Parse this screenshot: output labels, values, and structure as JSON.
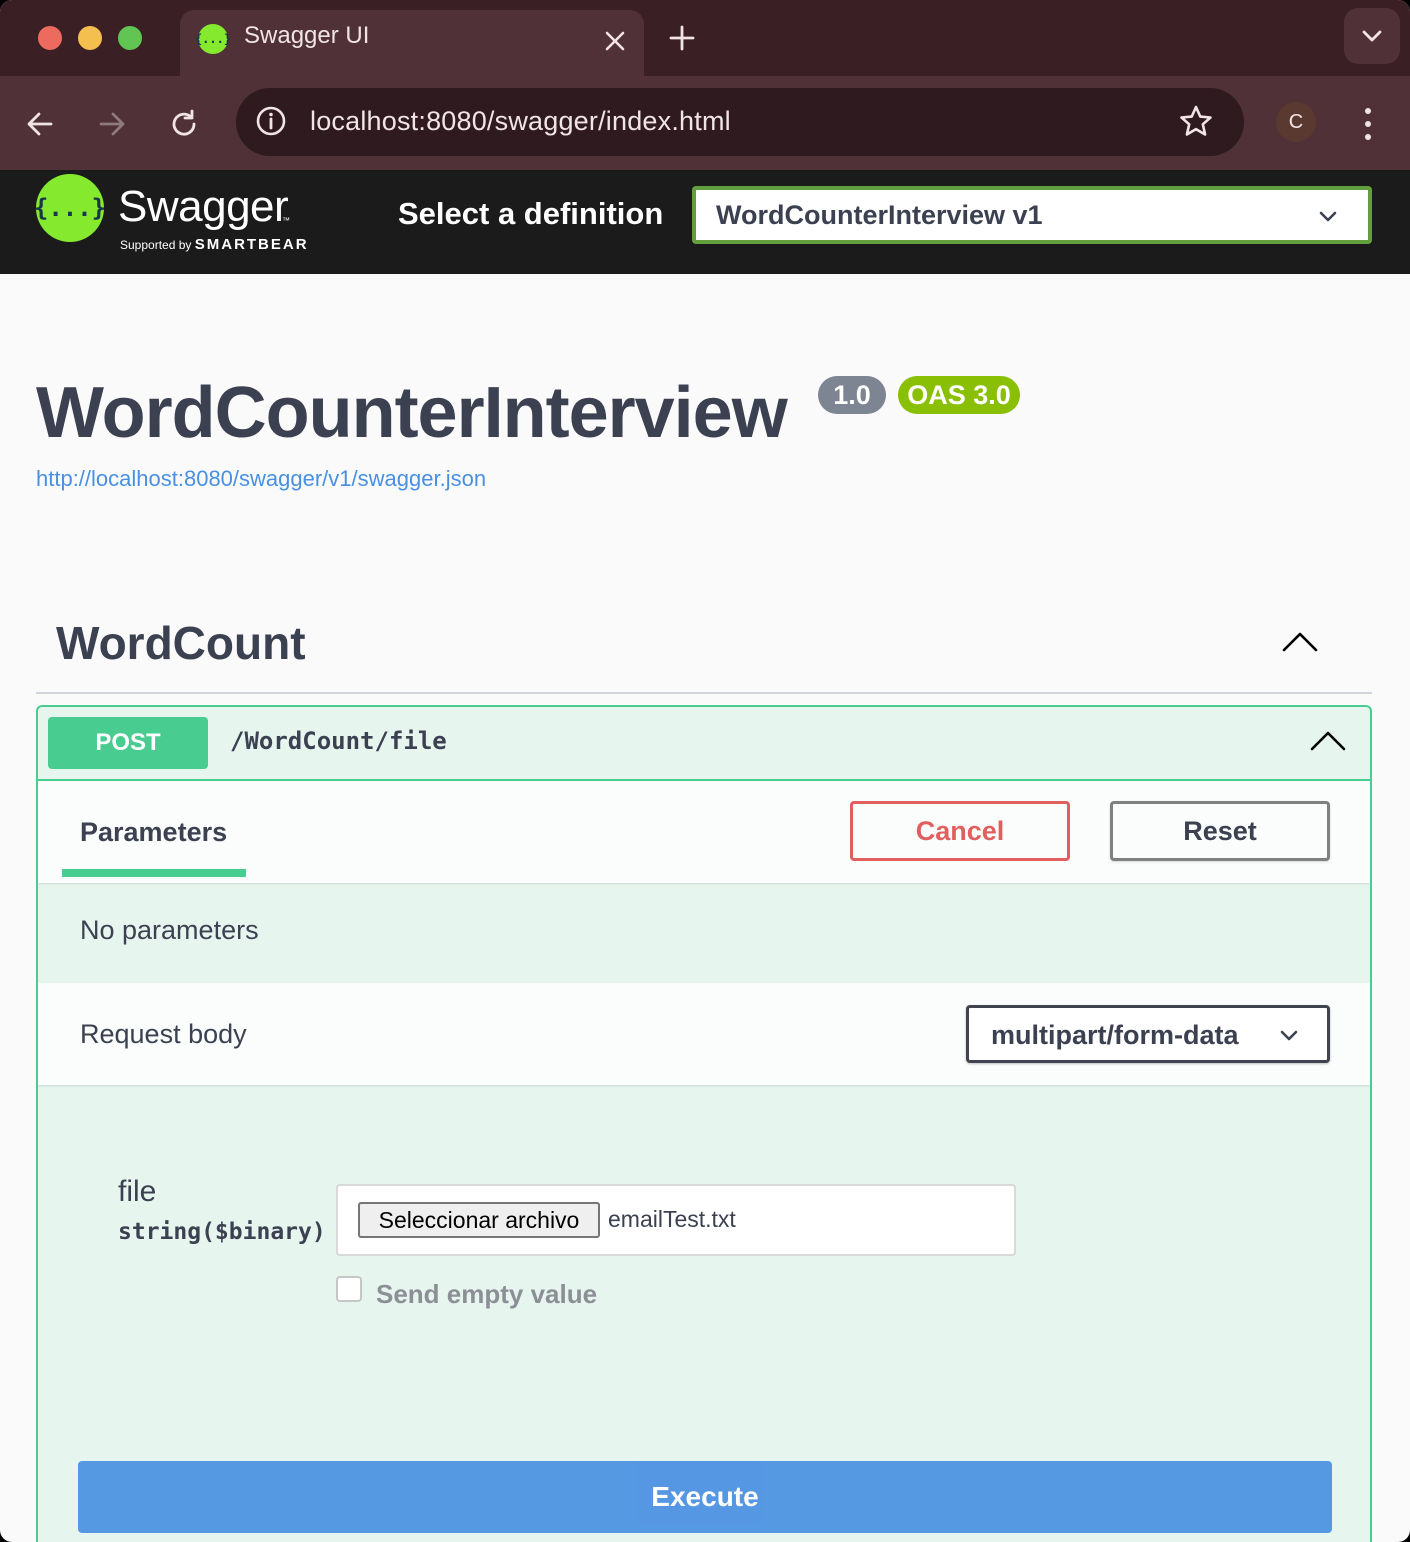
{
  "browser": {
    "tab": {
      "title": "Swagger UI",
      "favicon_text": "{...}"
    },
    "url": "localhost:8080/swagger/index.html",
    "profile_initial": "C",
    "icons": [
      "back-arrow-icon",
      "forward-arrow-icon",
      "reload-icon",
      "site-info-icon",
      "bookmark-star-icon",
      "kebab-menu-icon",
      "tab-list-chevron-icon",
      "close-icon",
      "plus-icon"
    ]
  },
  "topbar": {
    "logo_glyph": "{...}",
    "logo_text": "Swagger",
    "logo_tm": "™",
    "supported_by": "Supported by",
    "smartbear": "SMARTBEAR",
    "select_label": "Select a definition",
    "selected_definition": "WordCounterInterview v1"
  },
  "info": {
    "title": "WordCounterInterview",
    "version": "1.0",
    "oas": "OAS 3.0",
    "spec_url": "http://localhost:8080/swagger/v1/swagger.json"
  },
  "tag": {
    "name": "WordCount"
  },
  "operation": {
    "method": "POST",
    "path": "/WordCount/file",
    "parameters_tab": "Parameters",
    "cancel_label": "Cancel",
    "reset_label": "Reset",
    "no_parameters": "No parameters",
    "request_body_label": "Request body",
    "content_type": "multipart/form-data",
    "field": {
      "name": "file",
      "type": "string($binary)",
      "choose_button": "Seleccionar archivo",
      "chosen_file": "emailTest.txt",
      "send_empty_label": "Send empty value",
      "send_empty_checked": false
    },
    "execute_label": "Execute"
  },
  "colors": {
    "post_green": "#49cc90",
    "execute_blue": "#4990e2",
    "cancel_red": "#e06060",
    "swagger_green": "#85ea2d",
    "version_gray": "#7d8492",
    "oas_green": "#89bf04"
  }
}
